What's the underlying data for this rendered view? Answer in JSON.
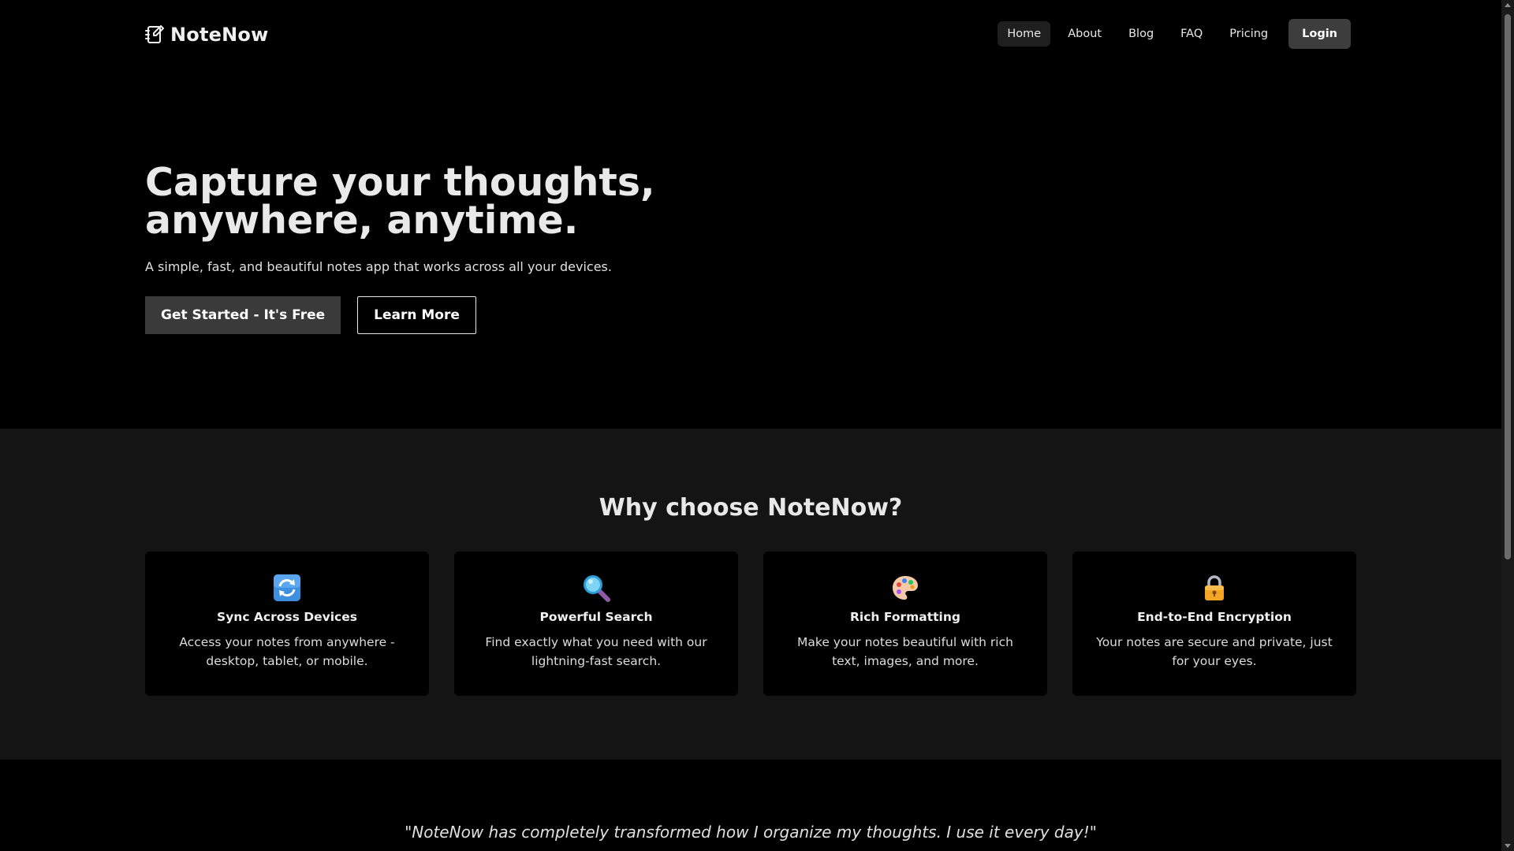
{
  "header": {
    "logo_icon": "notebook-pen-icon",
    "brand": "NoteNow",
    "nav": [
      {
        "label": "Home",
        "active": true
      },
      {
        "label": "About",
        "active": false
      },
      {
        "label": "Blog",
        "active": false
      },
      {
        "label": "FAQ",
        "active": false
      },
      {
        "label": "Pricing",
        "active": false
      }
    ],
    "login_label": "Login"
  },
  "hero": {
    "title_line1": "Capture your thoughts,",
    "title_line2": "anywhere, anytime.",
    "subtitle": "A simple, fast, and beautiful notes app that works across all your devices.",
    "primary_button": "Get Started - It's Free",
    "secondary_button": "Learn More"
  },
  "features": {
    "heading": "Why choose NoteNow?",
    "cards": [
      {
        "icon": "sync-arrows-icon",
        "title": "Sync Across Devices",
        "description": "Access your notes from anywhere - desktop, tablet, or mobile."
      },
      {
        "icon": "magnifying-glass-icon",
        "title": "Powerful Search",
        "description": "Find exactly what you need with our lightning-fast search."
      },
      {
        "icon": "palette-icon",
        "title": "Rich Formatting",
        "description": "Make your notes beautiful with rich text, images, and more."
      },
      {
        "icon": "lock-icon",
        "title": "End-to-End Encryption",
        "description": "Your notes are secure and private, just for your eyes."
      }
    ]
  },
  "testimonial": {
    "quote": "\"NoteNow has completely transformed how I organize my thoughts. I use it every day!\""
  },
  "colors": {
    "background": "#000000",
    "section_alt": "#141414",
    "button_primary": "#3a3a3a",
    "nav_active": "#1f1f1f",
    "login_bg": "#3d3d3d"
  }
}
